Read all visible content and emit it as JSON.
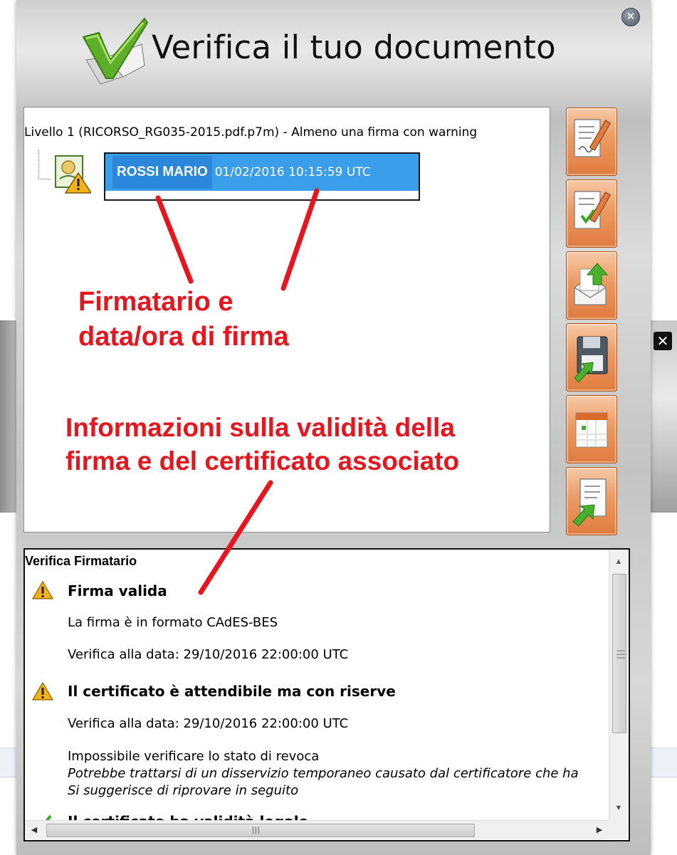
{
  "dialog": {
    "title": "Verifica il tuo documento",
    "close_icon": "close-circle-icon",
    "logo_icon": "green-checkmark-icon"
  },
  "tree": {
    "header": "Livello 1 (RICORSO_RG035-2015.pdf.p7m) - Almeno una firma con warning",
    "signer": {
      "name": "ROSSI MARIO",
      "date": "01/02/2016 10:15:59 UTC",
      "icon": "signature-certificate-warning-icon"
    }
  },
  "actions": [
    {
      "icon": "document-sign-icon"
    },
    {
      "icon": "document-verify-icon"
    },
    {
      "icon": "envelope-open-icon"
    },
    {
      "icon": "save-floppy-icon"
    },
    {
      "icon": "calendar-icon"
    },
    {
      "icon": "document-export-icon"
    }
  ],
  "details": {
    "title": "Verifica Firmatario",
    "section1": {
      "heading": "Firma valida",
      "line1": "La firma è in formato CAdES-BES",
      "line2": "Verifica alla data: 29/10/2016 22:00:00 UTC"
    },
    "section2": {
      "heading": "Il certificato è attendibile ma con riserve",
      "line1": "Verifica alla data: 29/10/2016 22:00:00 UTC",
      "line2": "Impossibile verificare lo stato di revoca",
      "line3": "Potrebbe trattarsi di un disservizio temporaneo causato dal certificatore che ha",
      "line4": "Si suggerisce di riprovare in seguito"
    },
    "section3": {
      "heading": "Il certificato ha validità legale"
    }
  },
  "annotations": {
    "signer_line1": "Firmatario e",
    "signer_line2": "data/ora di firma",
    "validity_line1": "Informazioni sulla validità della",
    "validity_line2": "firma e del certificato associato",
    "color": "#e8141e"
  },
  "colors": {
    "selection": "#3b9eea",
    "action_button": "#ec9a63",
    "warning": "#f2b118"
  }
}
